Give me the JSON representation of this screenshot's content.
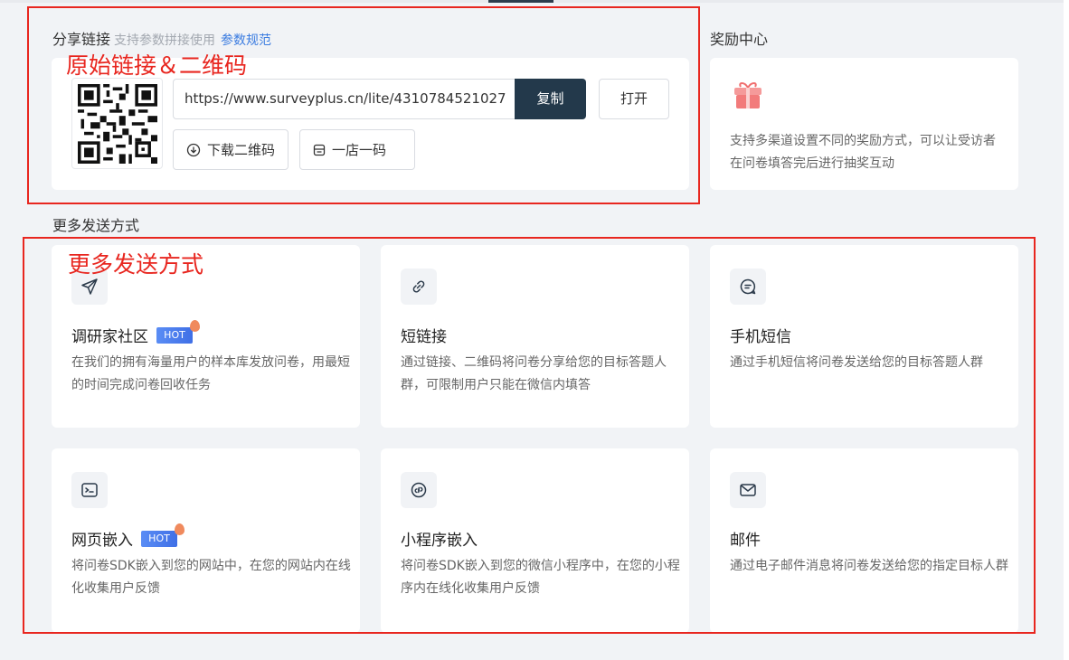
{
  "share": {
    "title": "分享链接",
    "subtitle": "支持参数拼接使用",
    "link": "参数规范",
    "url": "https://www.surveyplus.cn/lite/4310784521027",
    "copy_label": "复制",
    "open_label": "打开",
    "download_qr_label": "下载二维码",
    "shop_code_label": "一店一码"
  },
  "reward": {
    "title": "奖励中心",
    "description": "支持多渠道设置不同的奖励方式，可以让受访者在问卷填答完后进行抽奖互动"
  },
  "more": {
    "title": "更多发送方式",
    "hot_label": "HOT",
    "methods": [
      {
        "title": "调研家社区",
        "hot": true,
        "icon": "send-icon",
        "desc": "在我们的拥有海量用户的样本库发放问卷，用最短的时间完成问卷回收任务"
      },
      {
        "title": "短链接",
        "hot": false,
        "icon": "link-icon",
        "desc": "通过链接、二维码将问卷分享给您的目标答题人群，可限制用户只能在微信内填答"
      },
      {
        "title": "手机短信",
        "hot": false,
        "icon": "message-icon",
        "desc": "通过手机短信将问卷发送给您的目标答题人群"
      },
      {
        "title": "网页嵌入",
        "hot": true,
        "icon": "terminal-icon",
        "desc": "将问卷SDK嵌入到您的网站中，在您的网站内在线化收集用户反馈"
      },
      {
        "title": "小程序嵌入",
        "hot": false,
        "icon": "miniprogram-icon",
        "desc": "将问卷SDK嵌入到您的微信小程序中，在您的小程序内在线化收集用户反馈"
      },
      {
        "title": "邮件",
        "hot": false,
        "icon": "mail-icon",
        "desc": "通过电子邮件消息将问卷发送给您的指定目标人群"
      }
    ]
  },
  "annotations": {
    "share_label": "原始链接＆二维码",
    "more_label": "更多发送方式"
  },
  "colors": {
    "accent_dark": "#23394b",
    "link_blue": "#3b7ce0",
    "annotation_red": "#e8261f",
    "hot_blue": "#4a7cf0"
  }
}
